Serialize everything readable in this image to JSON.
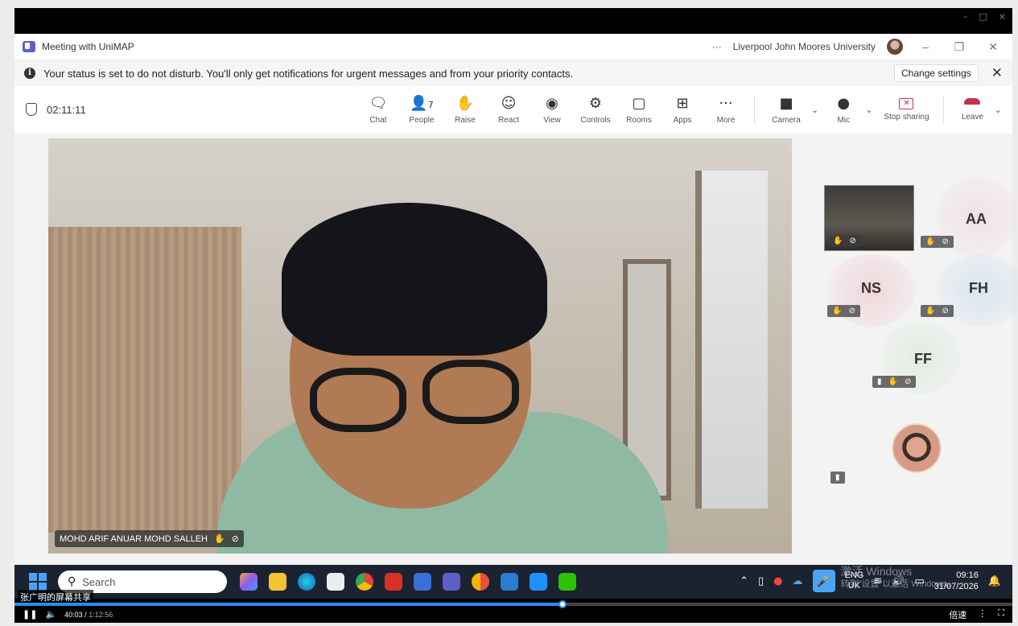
{
  "player": {
    "window_controls": [
      "–",
      "□",
      "×"
    ],
    "share_label": "张广明的屏幕共享",
    "current_time": "40:03",
    "total_time": "1:12:56",
    "progress": 0.549,
    "speed_label": "倍速"
  },
  "teams": {
    "window_title": "Meeting with UniMAP",
    "more_label": "···",
    "org_name": "Liverpool John Moores University",
    "notice": "Your status is set to do not disturb. You'll only get notifications for urgent messages and from your priority contacts.",
    "change_settings": "Change settings",
    "timer": "02:11:11",
    "tools": [
      {
        "icon": "chat-icon",
        "label": "Chat"
      },
      {
        "icon": "people-icon",
        "label": "People",
        "badge": "7"
      },
      {
        "icon": "raise-hand-icon",
        "label": "Raise"
      },
      {
        "icon": "react-icon",
        "label": "React"
      },
      {
        "icon": "view-icon",
        "label": "View"
      },
      {
        "icon": "controls-icon",
        "label": "Controls"
      },
      {
        "icon": "rooms-icon",
        "label": "Rooms"
      },
      {
        "icon": "apps-icon",
        "label": "Apps"
      },
      {
        "icon": "more-icon",
        "label": "More"
      },
      {
        "icon": "camera-off-icon",
        "label": "Camera"
      },
      {
        "icon": "mic-icon",
        "label": "Mic"
      },
      {
        "icon": "stop-sharing-icon",
        "label": "Stop sharing"
      },
      {
        "icon": "leave-icon",
        "label": "Leave"
      }
    ],
    "main_speaker": "MOHD ARIF ANUAR MOHD SALLEH",
    "participants": [
      {
        "initials": "AA"
      },
      {
        "initials": "NS"
      },
      {
        "initials": "FH"
      },
      {
        "initials": "FF"
      }
    ]
  },
  "taskbar": {
    "search_placeholder": "Search",
    "lang_1": "ENG",
    "lang_2": "UK",
    "time": "09:16",
    "date": "31/07/2026",
    "watermark_1": "激活 Windows",
    "watermark_2": "转到\"设置\"以激活 Windows。"
  },
  "colors": {
    "teams_purple": "#5b5fc7",
    "leave_red": "#c4314b",
    "progress_blue": "#2b8cf0"
  }
}
